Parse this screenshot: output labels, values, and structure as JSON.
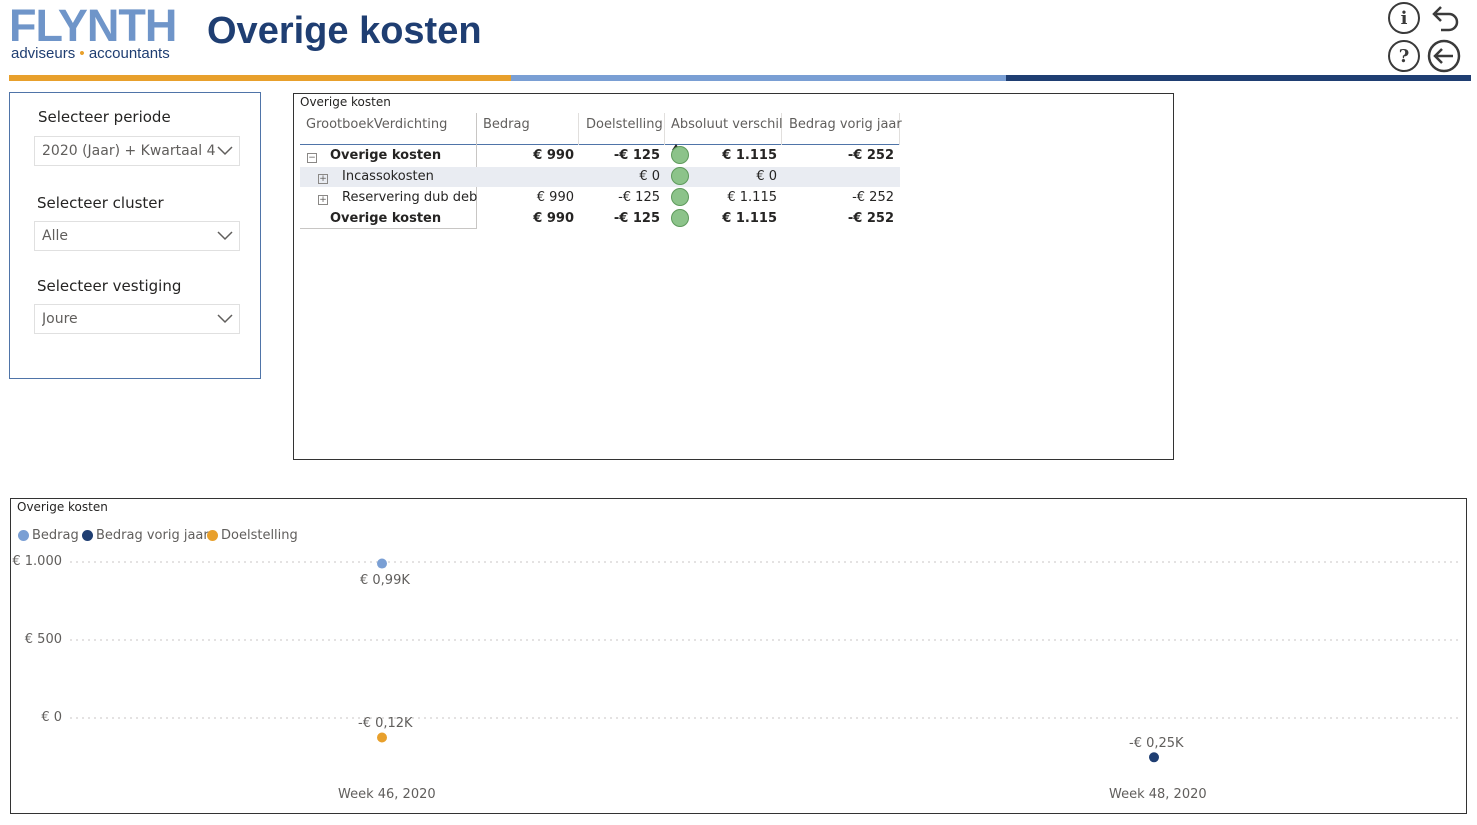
{
  "header": {
    "logo_main": "FLYNTH",
    "logo_sub_1": "adviseurs",
    "logo_sub_dot": "•",
    "logo_sub_2": "accountants",
    "title": "Overige kosten",
    "bar_colors": [
      "#e8a02c",
      "#7a9fd4",
      "#1f3e72"
    ]
  },
  "icons": [
    "info-icon",
    "undo-icon",
    "help-icon",
    "back-arrow-icon"
  ],
  "slicers": {
    "periode": {
      "label": "Selecteer periode",
      "value": "2020 (Jaar) + Kwartaal 4..."
    },
    "cluster": {
      "label": "Selecteer cluster",
      "value": "Alle"
    },
    "vestiging": {
      "label": "Selecteer vestiging",
      "value": "Joure"
    }
  },
  "table": {
    "title": "Overige kosten",
    "columns": [
      "GrootboekVerdichting",
      "Bedrag",
      "Doelstelling",
      "Absoluut verschil",
      "Bedrag vorig jaar"
    ],
    "rows": [
      {
        "expand": "−",
        "name": "Overige kosten",
        "bedrag": "€ 990",
        "doel": "-€ 125",
        "verschil": "€ 1.115",
        "vorig": "-€ 252"
      },
      {
        "expand": "+",
        "name": "Incassokosten",
        "bedrag": "",
        "doel": "€ 0",
        "verschil": "€ 0",
        "vorig": ""
      },
      {
        "expand": "+",
        "name": "Reservering dub deb",
        "bedrag": "€ 990",
        "doel": "-€ 125",
        "verschil": "€ 1.115",
        "vorig": "-€ 252"
      },
      {
        "expand": "",
        "name": "Overige kosten",
        "bedrag": "€ 990",
        "doel": "-€ 125",
        "verschil": "€ 1.115",
        "vorig": "-€ 252"
      }
    ]
  },
  "chart": {
    "title": "Overige kosten",
    "legend": [
      {
        "name": "Bedrag",
        "color": "#7a9fd4"
      },
      {
        "name": "Bedrag vorig jaar",
        "color": "#1f3e72"
      },
      {
        "name": "Doelstelling",
        "color": "#e8a02c"
      }
    ],
    "y_ticks": [
      "€ 1.000",
      "€ 500",
      "€ 0"
    ],
    "data_labels": [
      "€ 0,99K",
      "-€ 0,12K",
      "-€ 0,25K"
    ],
    "x_labels": [
      "Week 46, 2020",
      "Week 48, 2020"
    ]
  },
  "chart_data": {
    "type": "scatter",
    "title": "Overige kosten",
    "categories": [
      "Week 46, 2020",
      "Week 48, 2020"
    ],
    "series": [
      {
        "name": "Bedrag",
        "values": [
          990,
          null
        ]
      },
      {
        "name": "Bedrag vorig jaar",
        "values": [
          null,
          -252
        ]
      },
      {
        "name": "Doelstelling",
        "values": [
          -125,
          null
        ]
      }
    ],
    "ylim": [
      -300,
      1100
    ],
    "grid": true,
    "legend": "top-left"
  }
}
